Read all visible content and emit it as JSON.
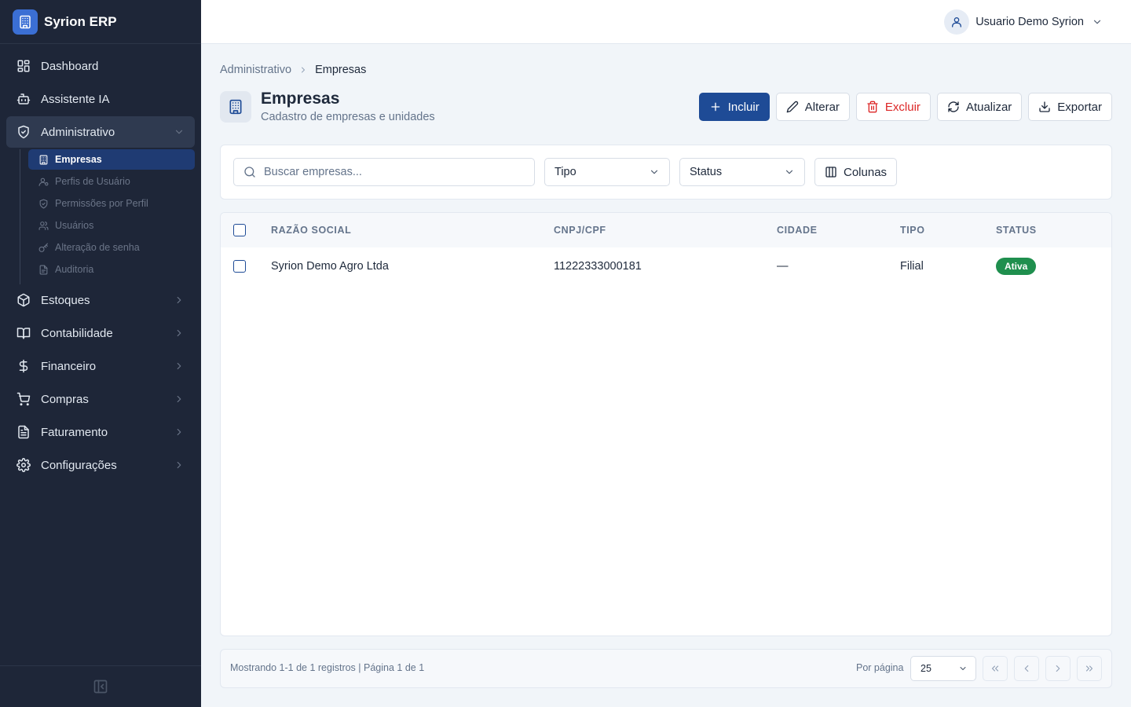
{
  "app": {
    "name": "Syrion ERP",
    "logo_icon": "building-icon"
  },
  "sidebar": {
    "items": [
      {
        "label": "Dashboard",
        "icon": "dashboard-icon"
      },
      {
        "label": "Assistente IA",
        "icon": "bot-icon"
      },
      {
        "label": "Administrativo",
        "icon": "shield-check-icon",
        "expanded": true
      },
      {
        "label": "Estoques",
        "icon": "package-icon"
      },
      {
        "label": "Contabilidade",
        "icon": "book-icon"
      },
      {
        "label": "Financeiro",
        "icon": "dollar-icon"
      },
      {
        "label": "Compras",
        "icon": "cart-icon"
      },
      {
        "label": "Faturamento",
        "icon": "invoice-icon"
      },
      {
        "label": "Configurações",
        "icon": "gear-icon"
      }
    ],
    "subitems": [
      {
        "label": "Empresas",
        "icon": "building-icon",
        "active": true
      },
      {
        "label": "Perfis de Usuário",
        "icon": "user-profile-icon"
      },
      {
        "label": "Permissões por Perfil",
        "icon": "shield-check-icon"
      },
      {
        "label": "Usuários",
        "icon": "users-icon"
      },
      {
        "label": "Alteração de senha",
        "icon": "key-icon"
      },
      {
        "label": "Auditoria",
        "icon": "audit-icon"
      }
    ],
    "collapse_icon": "sidebar-collapse-icon"
  },
  "topbar": {
    "user_name": "Usuario Demo Syrion",
    "avatar_icon": "user-icon"
  },
  "breadcrumb": {
    "parent": "Administrativo",
    "current": "Empresas"
  },
  "page": {
    "title": "Empresas",
    "subtitle": "Cadastro de empresas e unidades"
  },
  "actions": {
    "incluir": "Incluir",
    "alterar": "Alterar",
    "excluir": "Excluir",
    "atualizar": "Atualizar",
    "exportar": "Exportar"
  },
  "filters": {
    "search_placeholder": "Buscar empresas...",
    "tipo": "Tipo",
    "status": "Status",
    "colunas": "Colunas"
  },
  "table": {
    "columns": [
      "RAZÃO SOCIAL",
      "CNPJ/CPF",
      "CIDADE",
      "TIPO",
      "STATUS"
    ],
    "rows": [
      {
        "razao_social": "Syrion Demo Agro Ltda",
        "cnpj": "11222333000181",
        "cidade": "—",
        "tipo": "Filial",
        "status": "Ativa"
      }
    ]
  },
  "pagination": {
    "info": "Mostrando 1-1 de 1 registros | Página 1 de 1",
    "per_page_label": "Por página",
    "per_page": "25"
  },
  "colors": {
    "sidebar_bg": "#1e2638",
    "primary": "#1e4b96",
    "danger": "#dc2626",
    "success": "#1f8f4e",
    "active_subitem": "#1f3b73"
  }
}
